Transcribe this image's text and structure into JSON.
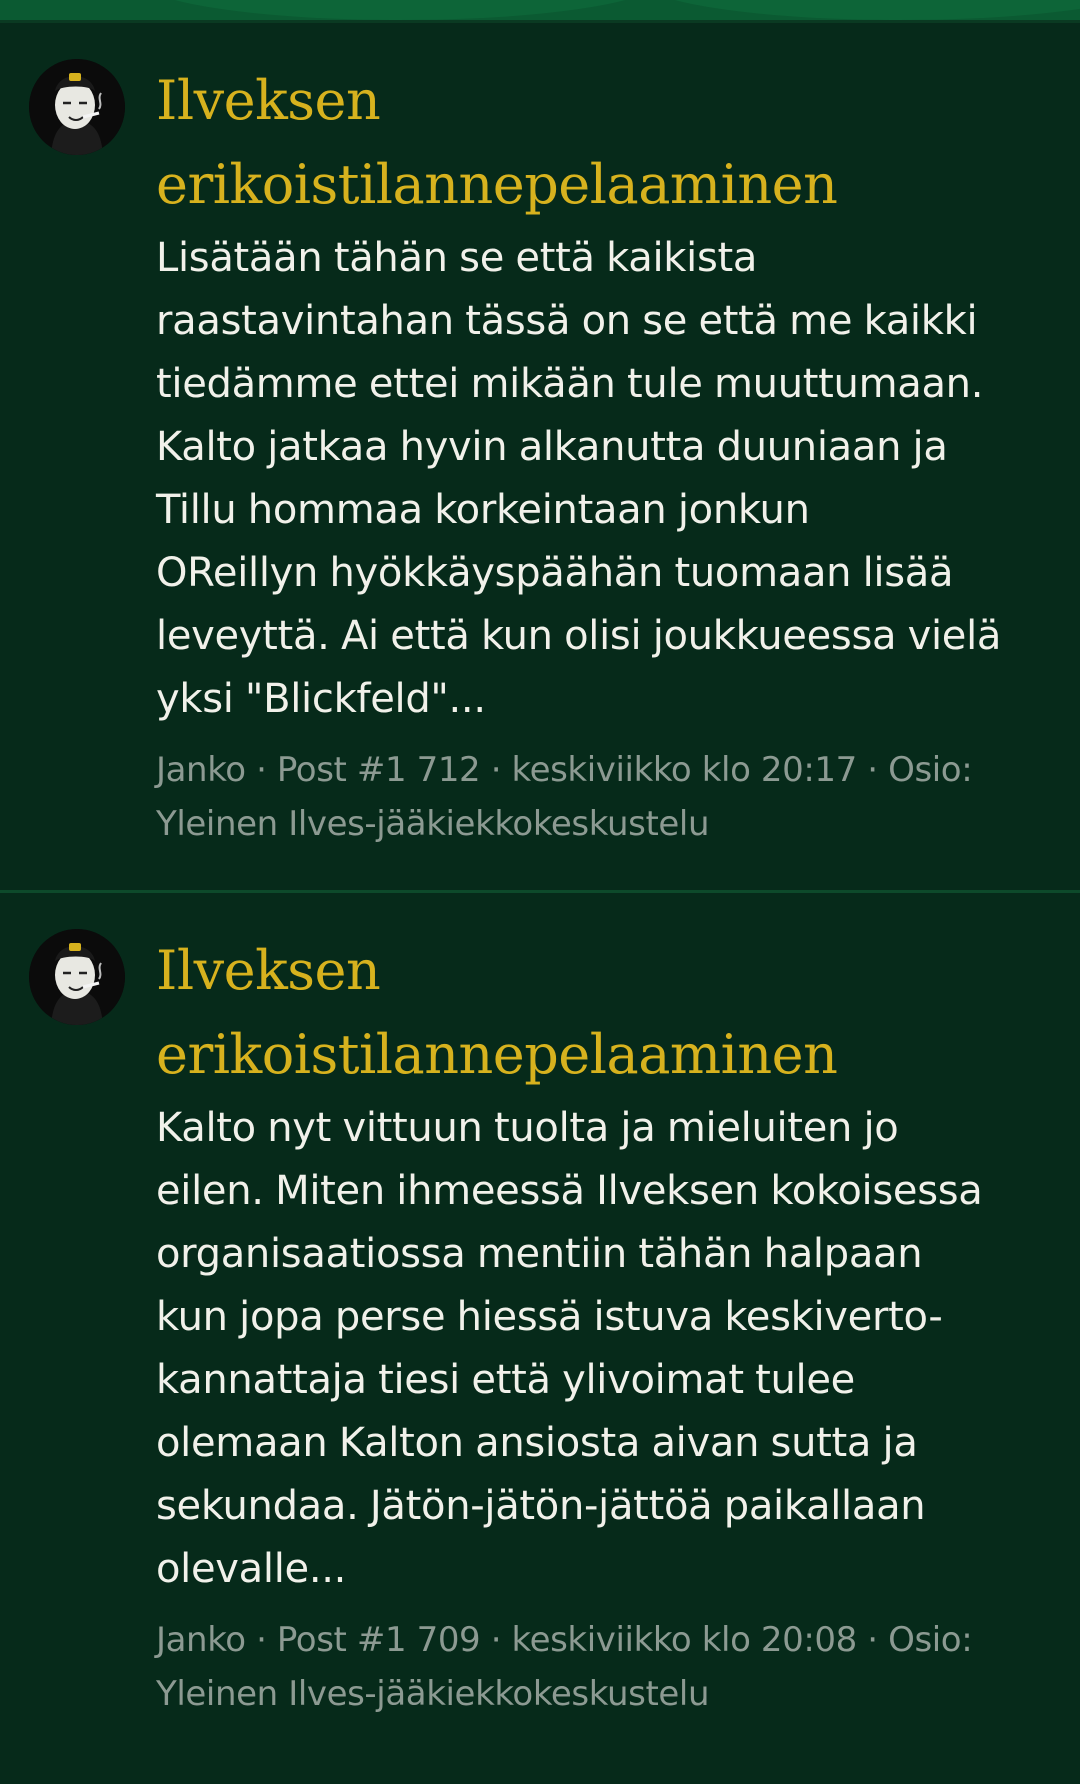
{
  "posts": [
    {
      "title": "Ilveksen\nerikoistilannepelaaminen",
      "text": "Lisätään tähän se että kaikista\nraastavintahan tässä on se että me kaikki\ntiedämme ettei mikään tule muuttumaan.\nKalto jatkaa hyvin alkanutta duuniaan ja\nTillu hommaa korkeintaan jonkun\nOReillyn hyökkäyspäähän tuomaan lisää\nleveyttä. Ai että kun olisi joukkueessa vielä\nyksi \"Blickfeld\"...",
      "meta": "Janko · Post #1 712 · keskiviikko klo 20:17 · Osio:\nYleinen Ilves-jääkiekkokeskustelu",
      "avatar_icon": "smoking-character-avatar"
    },
    {
      "title": "Ilveksen\nerikoistilannepelaaminen",
      "text": "Kalto nyt vittuun tuolta ja mieluiten jo\neilen. Miten ihmeessä Ilveksen kokoisessa\norganisaatiossa mentiin tähän halpaan\nkun jopa perse hiessä istuva keskiverto-\nkannattaja tiesi että ylivoimat tulee\nolemaan Kalton ansiosta aivan sutta ja\nsekundaa. Jätön-jätön-jättöä paikallaan\nolevalle...",
      "meta": "Janko · Post #1 709 · keskiviikko klo 20:08 · Osio:\nYleinen Ilves-jääkiekkokeskustelu",
      "avatar_icon": "smoking-character-avatar"
    }
  ],
  "colors": {
    "background": "#062a1a",
    "title": "#d7b21e",
    "text": "#f1f1ea",
    "meta": "#8c9a92",
    "divider": "#0d4a2b",
    "banner": "#0b5a32"
  }
}
